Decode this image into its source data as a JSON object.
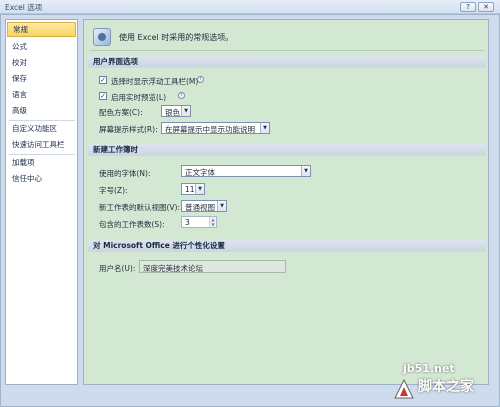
{
  "window": {
    "title": "Excel 选项",
    "help_glyph": "?",
    "close_glyph": "✕"
  },
  "sidebar": {
    "items": [
      {
        "label": "常规",
        "selected": true
      },
      {
        "label": "公式"
      },
      {
        "label": "校对"
      },
      {
        "label": "保存"
      },
      {
        "label": "语言"
      },
      {
        "label": "高级"
      },
      {
        "label": "自定义功能区"
      },
      {
        "label": "快速访问工具栏"
      },
      {
        "label": "加载项"
      },
      {
        "label": "信任中心"
      }
    ]
  },
  "main": {
    "intro": "使用 Excel 时采用的常规选项。",
    "ui_section": {
      "heading": "用户界面选项",
      "show_minitoolbar": {
        "label": "选择时显示浮动工具栏(M)",
        "checked": true,
        "icon": "info-icon"
      },
      "live_preview": {
        "label": "启用实时预览(L)",
        "checked": true,
        "icon": "info-icon"
      },
      "color_scheme": {
        "label": "配色方案(C):",
        "value": "银色"
      },
      "screentip_style": {
        "label": "屏幕提示样式(R):",
        "value": "在屏幕提示中显示功能说明"
      }
    },
    "workbook_section": {
      "heading": "新建工作簿时",
      "font": {
        "label": "使用的字体(N):",
        "value": "正文字体"
      },
      "size": {
        "label": "字号(Z):",
        "value": "11"
      },
      "default_view": {
        "label": "新工作表的默认视图(V):",
        "value": "普通视图"
      },
      "sheet_count": {
        "label": "包含的工作表数(S):",
        "value": "3"
      }
    },
    "personalize_section": {
      "heading": "对 Microsoft Office 进行个性化设置",
      "username": {
        "label": "用户名(U):",
        "value": "深度完美技术论坛"
      }
    },
    "check_glyph": "✓",
    "dropdown_glyph": "▼",
    "spin_up_glyph": "▲",
    "spin_down_glyph": "▼"
  },
  "watermark": {
    "url": "jb51.net",
    "logo_text": "脚本之家"
  }
}
